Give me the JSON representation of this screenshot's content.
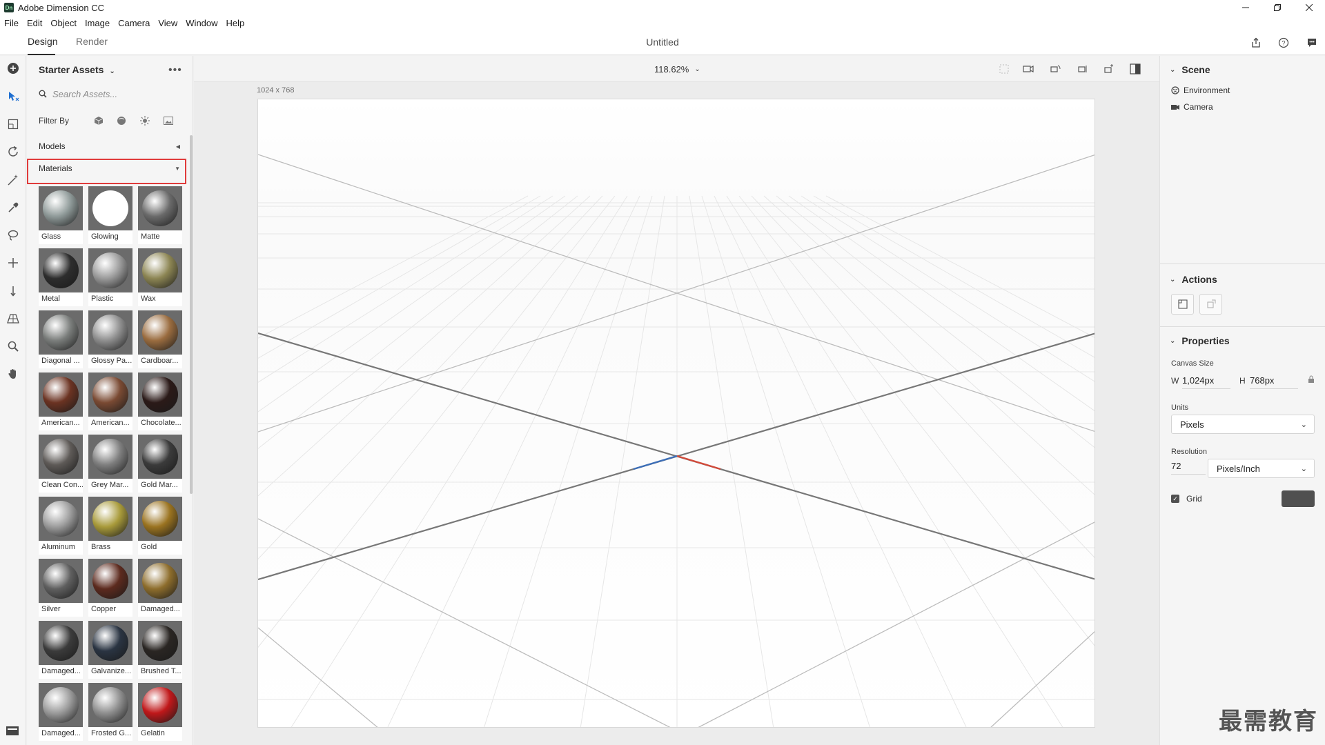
{
  "window": {
    "title": "Adobe Dimension CC",
    "logo": "Dn"
  },
  "menu": [
    "File",
    "Edit",
    "Object",
    "Image",
    "Camera",
    "View",
    "Window",
    "Help"
  ],
  "tabs": {
    "design": "Design",
    "render": "Render"
  },
  "document": {
    "title": "Untitled"
  },
  "assets": {
    "header": "Starter Assets",
    "more": "•••",
    "search_placeholder": "Search Assets...",
    "filter_label": "Filter By",
    "models_label": "Models",
    "materials_label": "Materials",
    "materials": [
      {
        "name": "Glass",
        "color": "#8f9a99"
      },
      {
        "name": "Glowing",
        "color": "#ffffff"
      },
      {
        "name": "Matte",
        "color": "#6a6a6a"
      },
      {
        "name": "Metal",
        "color": "#2d2d2d"
      },
      {
        "name": "Plastic",
        "color": "#9a9a9a"
      },
      {
        "name": "Wax",
        "color": "#8c8553"
      },
      {
        "name": "Diagonal ...",
        "color": "#7a7d7b"
      },
      {
        "name": "Glossy Pa...",
        "color": "#8e8e8e"
      },
      {
        "name": "Cardboar...",
        "color": "#9a6c3f"
      },
      {
        "name": "American...",
        "color": "#6b3322"
      },
      {
        "name": "American...",
        "color": "#7a4a33"
      },
      {
        "name": "Chocolate...",
        "color": "#2b1a18"
      },
      {
        "name": "Clean Con...",
        "color": "#5e5a57"
      },
      {
        "name": "Grey Mar...",
        "color": "#7f7f7f"
      },
      {
        "name": "Gold Mar...",
        "color": "#3b3b3b"
      },
      {
        "name": "Aluminum",
        "color": "#9c9c9c"
      },
      {
        "name": "Brass",
        "color": "#a89a3a"
      },
      {
        "name": "Gold",
        "color": "#9a7320"
      },
      {
        "name": "Silver",
        "color": "#5f5f5f"
      },
      {
        "name": "Copper",
        "color": "#5c2a1e"
      },
      {
        "name": "Damaged...",
        "color": "#8d6d2c"
      },
      {
        "name": "Damaged...",
        "color": "#3b3b3b"
      },
      {
        "name": "Galvanize...",
        "color": "#2a3442"
      },
      {
        "name": "Brushed T...",
        "color": "#2a2623"
      },
      {
        "name": "Damaged...",
        "color": "#9b9b9b"
      },
      {
        "name": "Frosted G...",
        "color": "#8f8f8f"
      },
      {
        "name": "Gelatin",
        "color": "#c0181a"
      }
    ]
  },
  "canvas": {
    "zoom": "118.62%",
    "dimensions": "1024 x 768"
  },
  "panel": {
    "scene_title": "Scene",
    "environment": "Environment",
    "camera": "Camera",
    "actions_title": "Actions",
    "properties_title": "Properties",
    "canvas_size_label": "Canvas Size",
    "w_label": "W",
    "w_value": "1,024px",
    "h_label": "H",
    "h_value": "768px",
    "units_label": "Units",
    "units_value": "Pixels",
    "resolution_label": "Resolution",
    "resolution_value": "72",
    "resolution_unit": "Pixels/Inch",
    "grid_label": "Grid",
    "grid_checked": true
  },
  "watermark": "最需教育"
}
